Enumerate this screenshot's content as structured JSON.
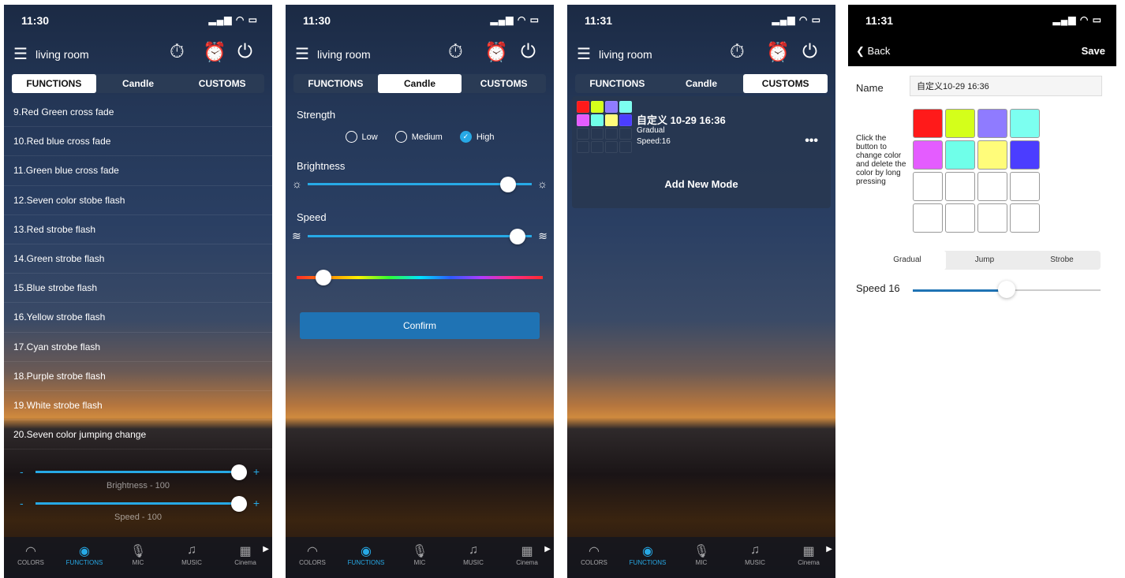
{
  "screens": [
    {
      "time": "11:30",
      "room": "living room",
      "tabs": [
        "FUNCTIONS",
        "Candle",
        "CUSTOMS"
      ],
      "active_tab": 0,
      "list": [
        "9.Red Green cross fade",
        "10.Red blue cross fade",
        "11.Green blue cross fade",
        "12.Seven color stobe flash",
        "13.Red strobe flash",
        "14.Green strobe flash",
        "15.Blue strobe flash",
        "16.Yellow strobe flash",
        "17.Cyan strobe flash",
        "18.Purple strobe flash",
        "19.White strobe flash",
        "20.Seven color jumping change"
      ],
      "brightness_caption": "Brightness - 100",
      "speed_caption": "Speed - 100",
      "brightness_value": 100,
      "speed_value": 100
    },
    {
      "time": "11:30",
      "room": "living room",
      "tabs": [
        "FUNCTIONS",
        "Candle",
        "CUSTOMS"
      ],
      "active_tab": 1,
      "strength_label": "Strength",
      "radios": [
        "Low",
        "Medium",
        "High"
      ],
      "selected_radio": 2,
      "brightness_label": "Brightness",
      "speed_label": "Speed",
      "confirm_label": "Confirm"
    },
    {
      "time": "11:31",
      "room": "living room",
      "tabs": [
        "FUNCTIONS",
        "Candle",
        "CUSTOMS"
      ],
      "active_tab": 2,
      "custom": {
        "title": "自定义 10-29 16:36",
        "mode": "Gradual",
        "speed": "Speed:16"
      },
      "add_new": "Add New Mode"
    }
  ],
  "nav": {
    "items": [
      "COLORS",
      "FUNCTIONS",
      "MIC",
      "MUSIC",
      "Cinema"
    ],
    "active": 1
  },
  "editor": {
    "time": "11:31",
    "back": "Back",
    "save": "Save",
    "name_label": "Name",
    "name_value": "自定义10-29 16:36",
    "help": "Click the button to change color and delete the color by long pressing",
    "grid_colors": [
      "#ff1a1a",
      "#d4ff1a",
      "#8f7bff",
      "#7cfff0",
      "#e45cff",
      "#6fffe9",
      "#fffc7a",
      "#4b3dff",
      "",
      "",
      "",
      "",
      "",
      "",
      "",
      ""
    ],
    "segments": [
      "Gradual",
      "Jump",
      "Strobe"
    ],
    "active_segment": 0,
    "speed_label": "Speed 16",
    "speed_value": 16
  },
  "colors": {
    "accent": "#27a9e6",
    "confirm": "#1f73b4"
  }
}
